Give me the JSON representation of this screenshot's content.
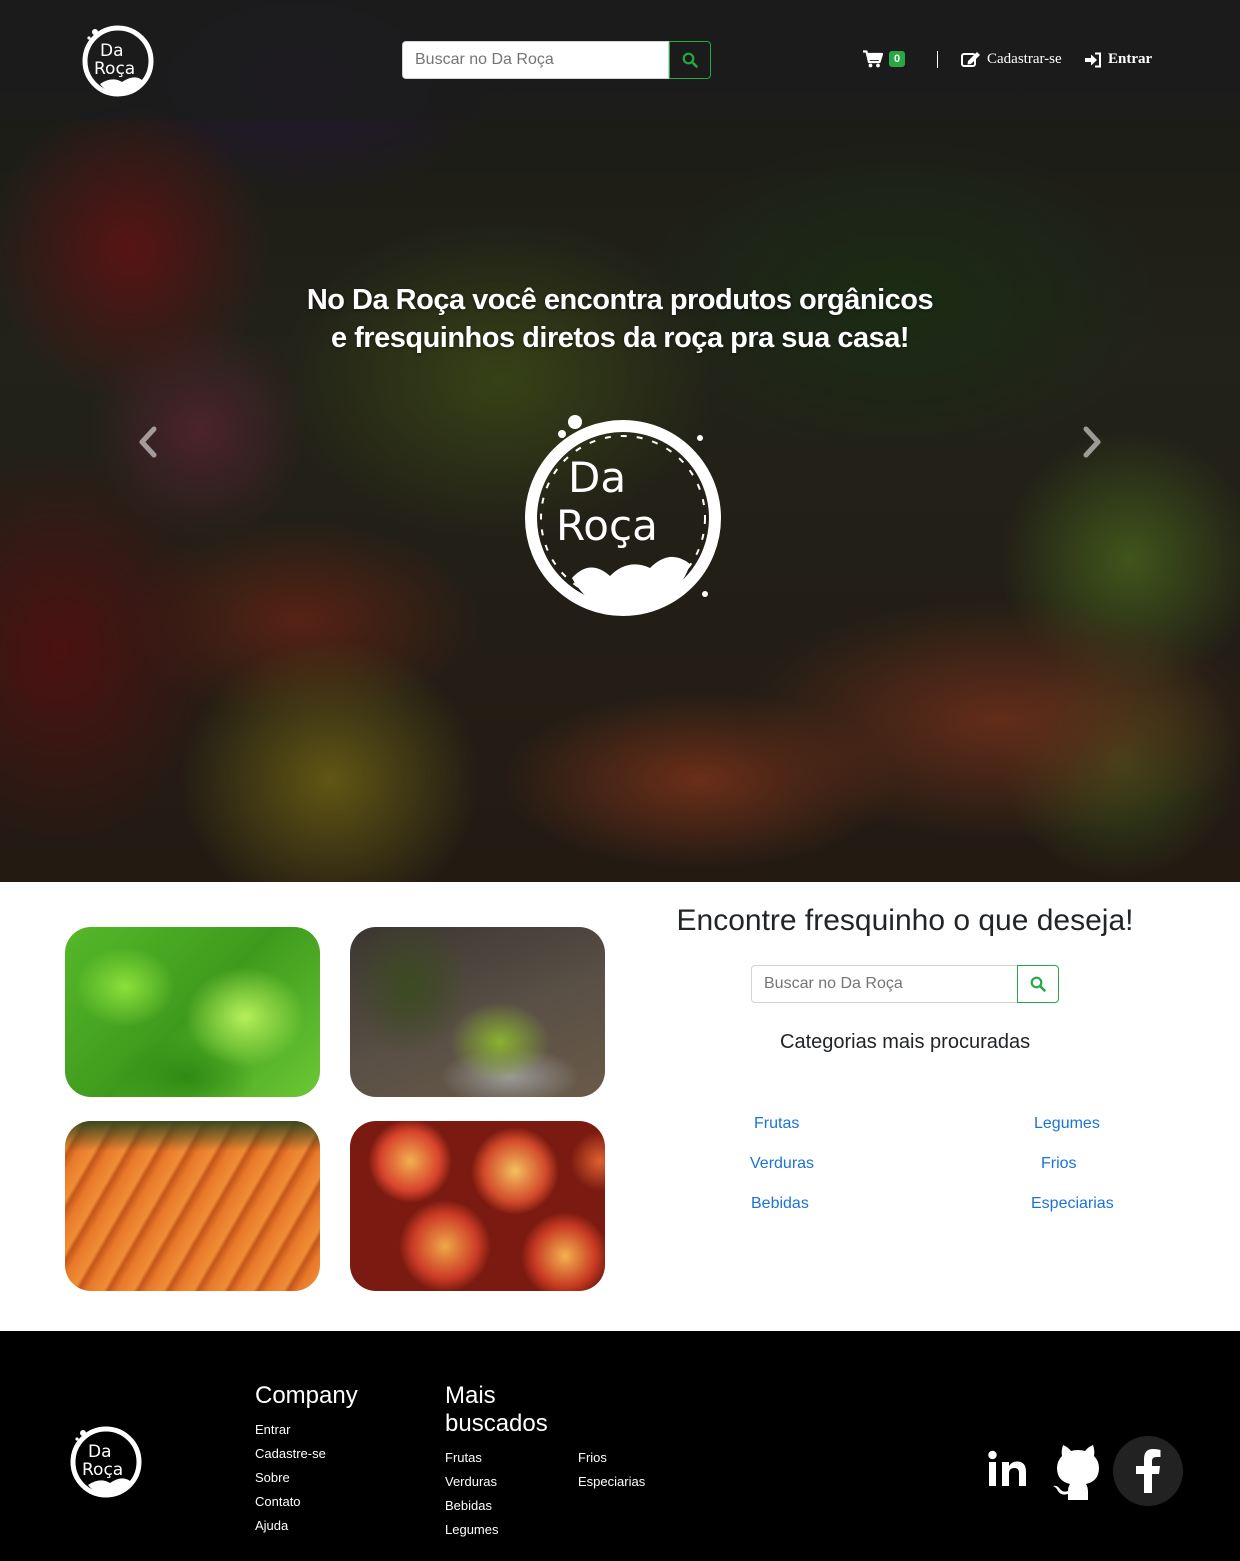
{
  "header": {
    "search_placeholder": "Buscar no Da Roça",
    "cart_count": "0",
    "signup_label": "Cadastrar-se",
    "login_label": "Entrar"
  },
  "logo": {
    "line1": "Da",
    "line2": "Roça"
  },
  "hero": {
    "title_line1": "No Da Roça você encontra produtos orgânicos",
    "title_line2": "e fresquinhos diretos da roça pra sua casa!"
  },
  "categories_section": {
    "title": "Encontre fresquinho o que deseja!",
    "search_placeholder": "Buscar no Da Roça",
    "subtitle": "Categorias mais procuradas",
    "links": [
      "Frutas",
      "Legumes",
      "Verduras",
      "Frios",
      "Bebidas",
      "Especiarias"
    ]
  },
  "footer": {
    "company_title": "Company",
    "company_links": [
      "Entrar",
      "Cadastre-se",
      "Sobre",
      "Contato",
      "Ajuda"
    ],
    "popular_title_line1": "Mais",
    "popular_title_line2": "buscados",
    "popular_links_col1": [
      "Frutas",
      "Verduras",
      "Bebidas",
      "Legumes"
    ],
    "popular_links_col2": [
      "Frios",
      "Especiarias"
    ],
    "social_icons": [
      "linkedin-icon",
      "github-icon",
      "facebook-icon"
    ]
  },
  "colors": {
    "accent_green": "#28a745",
    "link_blue": "#1a73d9",
    "footer_bg": "#000000"
  }
}
